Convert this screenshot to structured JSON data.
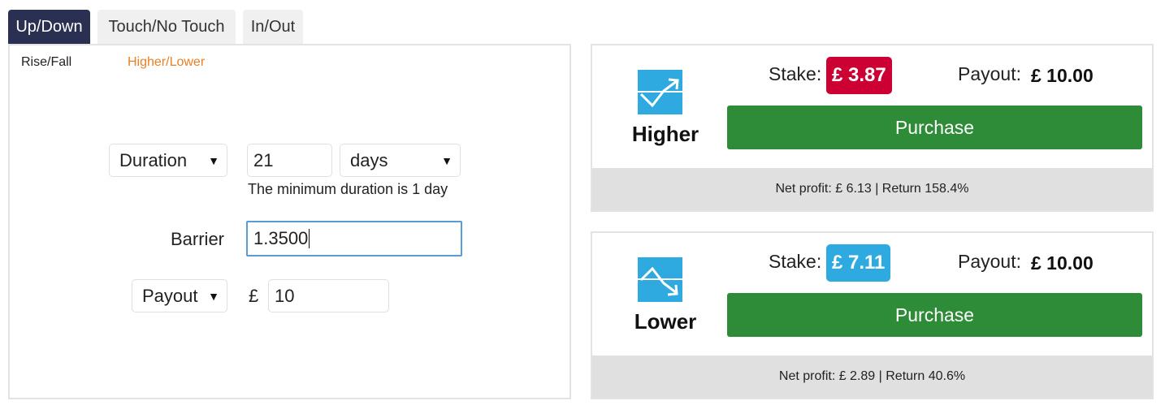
{
  "tabs": [
    {
      "label": "Up/Down",
      "active": true
    },
    {
      "label": "Touch/No Touch",
      "active": false
    },
    {
      "label": "In/Out",
      "active": false
    }
  ],
  "subtabs": [
    {
      "label": "Rise/Fall",
      "active": false
    },
    {
      "label": "Higher/Lower",
      "active": true
    }
  ],
  "form": {
    "duration_type": "Duration",
    "duration_value": "21",
    "duration_unit": "days",
    "duration_hint": "The minimum duration is 1 day",
    "barrier_label": "Barrier",
    "barrier_value": "1.3500",
    "amount_type": "Payout",
    "currency_symbol": "£",
    "amount_value": "10",
    "dropdown_arrow": "▼"
  },
  "contracts": [
    {
      "name": "Higher",
      "icon": "higher-arrow-icon",
      "stake_label": "Stake:",
      "stake": "£ 3.87",
      "stake_color": "#cc0033",
      "payout_label": "Payout:",
      "payout": "£ 10.00",
      "purchase_label": "Purchase",
      "footer": "Net profit: £ 6.13 | Return 158.4%"
    },
    {
      "name": "Lower",
      "icon": "lower-arrow-icon",
      "stake_label": "Stake:",
      "stake": "£ 7.11",
      "stake_color": "#2eaae1",
      "payout_label": "Payout:",
      "payout": "£ 10.00",
      "purchase_label": "Purchase",
      "footer": "Net profit: £ 2.89 | Return 40.6%"
    }
  ],
  "colors": {
    "active_tab": "#2a3052",
    "active_subtab": "#e98024",
    "purchase": "#2e8b37",
    "icon_bg": "#2eaae1"
  }
}
